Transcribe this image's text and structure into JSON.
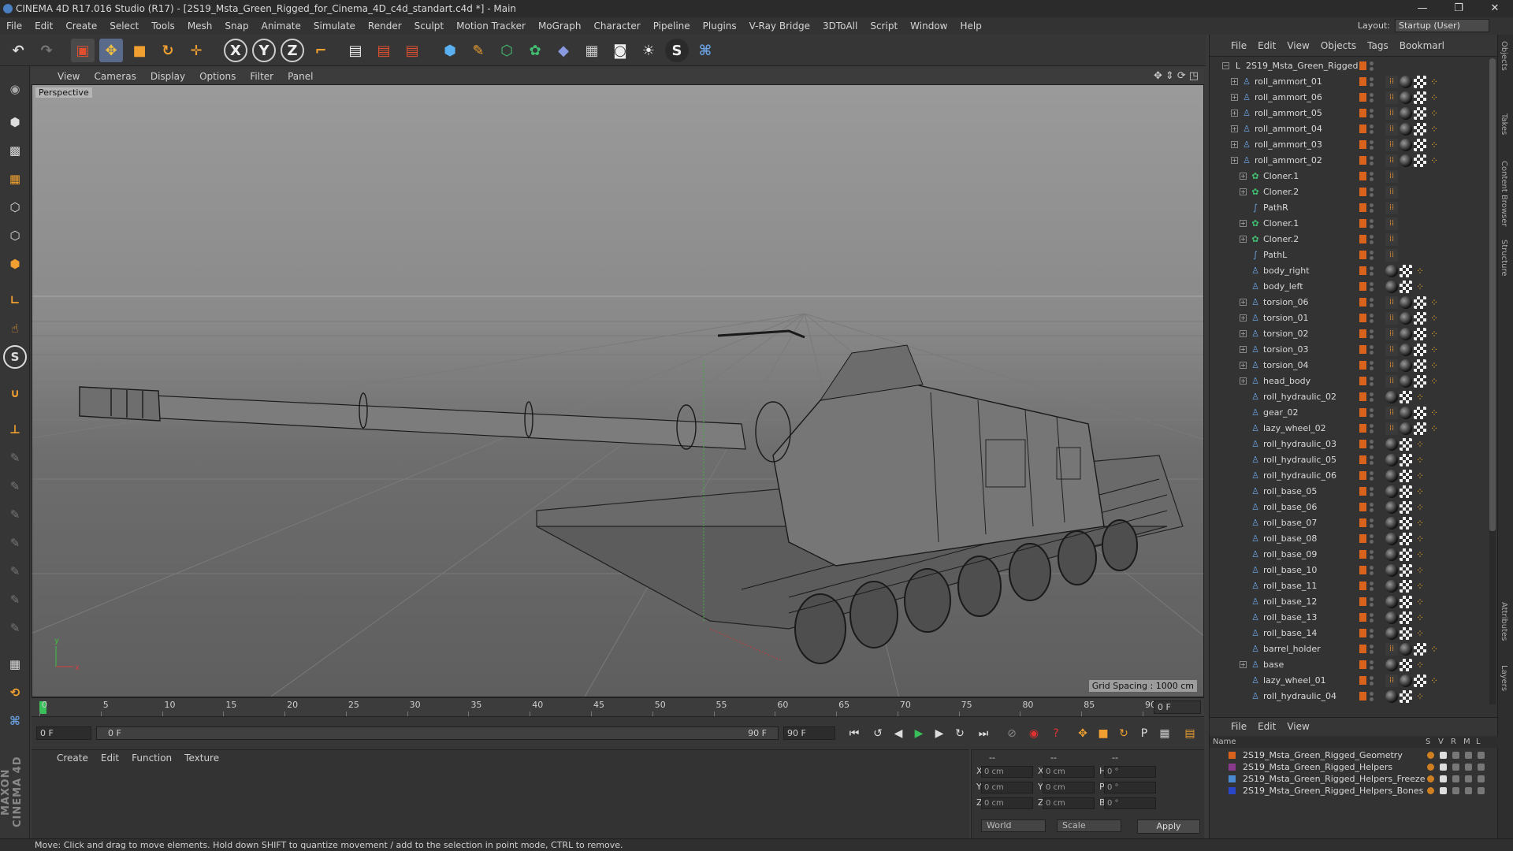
{
  "window": {
    "title": "CINEMA 4D R17.016 Studio (R17) - [2S19_Msta_Green_Rigged_for_Cinema_4D_c4d_standart.c4d *] - Main",
    "buttons": [
      "—",
      "❐",
      "✕"
    ]
  },
  "menubar": {
    "items": [
      "File",
      "Edit",
      "Create",
      "Select",
      "Tools",
      "Mesh",
      "Snap",
      "Animate",
      "Simulate",
      "Render",
      "Sculpt",
      "Motion Tracker",
      "MoGraph",
      "Character",
      "Pipeline",
      "Plugins",
      "V-Ray Bridge",
      "3DToAll",
      "Script",
      "Window",
      "Help"
    ],
    "layout_label": "Layout:",
    "layout_value": "Startup (User)"
  },
  "toolbar": {
    "axis_x": "X",
    "axis_y": "Y",
    "axis_z": "Z"
  },
  "viewport": {
    "menu": [
      "View",
      "Cameras",
      "Display",
      "Options",
      "Filter",
      "Panel"
    ],
    "label": "Perspective",
    "grid_spacing": "Grid Spacing : 1000 cm"
  },
  "timeline": {
    "ticks": [
      "0",
      "5",
      "10",
      "15",
      "20",
      "25",
      "30",
      "35",
      "40",
      "45",
      "50",
      "55",
      "60",
      "65",
      "70",
      "75",
      "80",
      "85",
      "90"
    ],
    "end_field": "0 F"
  },
  "playbar": {
    "current_frame": "0 F",
    "range_start": "0 F",
    "range_end_inner": "90 F",
    "range_end": "90 F"
  },
  "material_panel": {
    "menu": [
      "Create",
      "Edit",
      "Function",
      "Texture"
    ]
  },
  "coords": {
    "header_a": "--",
    "header_b": "--",
    "header_c": "--",
    "rows": [
      {
        "axis": "X",
        "pos": "0 cm",
        "axis2": "X",
        "size": "0 cm",
        "axis3": "H",
        "rot": "0 °"
      },
      {
        "axis": "Y",
        "pos": "0 cm",
        "axis2": "Y",
        "size": "0 cm",
        "axis3": "P",
        "rot": "0 °"
      },
      {
        "axis": "Z",
        "pos": "0 cm",
        "axis2": "Z",
        "size": "0 cm",
        "axis3": "B",
        "rot": "0 °"
      }
    ],
    "world_select": "World",
    "scale_select": "Scale",
    "apply": "Apply"
  },
  "object_manager": {
    "menu": [
      "File",
      "Edit",
      "View",
      "Objects",
      "Tags",
      "Bookmarl"
    ],
    "objects": [
      {
        "name": "2S19_Msta_Green_Rigged",
        "indent": 0,
        "icon": "null",
        "expand": "−",
        "tags": []
      },
      {
        "name": "roll_ammort_01",
        "indent": 1,
        "icon": "joint",
        "expand": "+",
        "tags": [
          "tex",
          "sph",
          "chk",
          "dot"
        ]
      },
      {
        "name": "roll_ammort_06",
        "indent": 1,
        "icon": "joint",
        "expand": "+",
        "tags": [
          "tex",
          "sph",
          "chk",
          "dot"
        ]
      },
      {
        "name": "roll_ammort_05",
        "indent": 1,
        "icon": "joint",
        "expand": "+",
        "tags": [
          "tex",
          "sph",
          "chk",
          "dot"
        ]
      },
      {
        "name": "roll_ammort_04",
        "indent": 1,
        "icon": "joint",
        "expand": "+",
        "tags": [
          "tex",
          "sph",
          "chk",
          "dot"
        ]
      },
      {
        "name": "roll_ammort_03",
        "indent": 1,
        "icon": "joint",
        "expand": "+",
        "tags": [
          "tex",
          "sph",
          "chk",
          "dot"
        ]
      },
      {
        "name": "roll_ammort_02",
        "indent": 1,
        "icon": "joint",
        "expand": "+",
        "tags": [
          "tex",
          "sph",
          "chk",
          "dot"
        ]
      },
      {
        "name": "Cloner.1",
        "indent": 2,
        "icon": "cloner",
        "expand": "+",
        "tags": [
          "tex"
        ]
      },
      {
        "name": "Cloner.2",
        "indent": 2,
        "icon": "cloner",
        "expand": "+",
        "tags": [
          "tex"
        ]
      },
      {
        "name": "PathR",
        "indent": 2,
        "icon": "spline",
        "expand": "",
        "tags": [
          "tex"
        ]
      },
      {
        "name": "Cloner.1",
        "indent": 2,
        "icon": "cloner",
        "expand": "+",
        "tags": [
          "tex"
        ]
      },
      {
        "name": "Cloner.2",
        "indent": 2,
        "icon": "cloner",
        "expand": "+",
        "tags": [
          "tex"
        ]
      },
      {
        "name": "PathL",
        "indent": 2,
        "icon": "spline",
        "expand": "",
        "tags": [
          "tex"
        ]
      },
      {
        "name": "body_right",
        "indent": 2,
        "icon": "joint",
        "expand": "",
        "tags": [
          "sph",
          "chk",
          "dot"
        ]
      },
      {
        "name": "body_left",
        "indent": 2,
        "icon": "joint",
        "expand": "",
        "tags": [
          "sph",
          "chk",
          "dot"
        ]
      },
      {
        "name": "torsion_06",
        "indent": 2,
        "icon": "joint",
        "expand": "+",
        "tags": [
          "tex",
          "sph",
          "chk",
          "dot"
        ]
      },
      {
        "name": "torsion_01",
        "indent": 2,
        "icon": "joint",
        "expand": "+",
        "tags": [
          "tex",
          "sph",
          "chk",
          "dot"
        ]
      },
      {
        "name": "torsion_02",
        "indent": 2,
        "icon": "joint",
        "expand": "+",
        "tags": [
          "tex",
          "sph",
          "chk",
          "dot"
        ]
      },
      {
        "name": "torsion_03",
        "indent": 2,
        "icon": "joint",
        "expand": "+",
        "tags": [
          "tex",
          "sph",
          "chk",
          "dot"
        ]
      },
      {
        "name": "torsion_04",
        "indent": 2,
        "icon": "joint",
        "expand": "+",
        "tags": [
          "tex",
          "sph",
          "chk",
          "dot"
        ]
      },
      {
        "name": "head_body",
        "indent": 2,
        "icon": "joint",
        "expand": "+",
        "tags": [
          "tex",
          "sph",
          "chk",
          "dot"
        ]
      },
      {
        "name": "roll_hydraulic_02",
        "indent": 2,
        "icon": "joint",
        "expand": "",
        "tags": [
          "sph",
          "chk",
          "dot"
        ]
      },
      {
        "name": "gear_02",
        "indent": 2,
        "icon": "joint",
        "expand": "",
        "tags": [
          "tex",
          "sph",
          "chk",
          "dot"
        ]
      },
      {
        "name": "lazy_wheel_02",
        "indent": 2,
        "icon": "joint",
        "expand": "",
        "tags": [
          "tex",
          "sph",
          "chk",
          "dot"
        ]
      },
      {
        "name": "roll_hydraulic_03",
        "indent": 2,
        "icon": "joint",
        "expand": "",
        "tags": [
          "sph",
          "chk",
          "dot"
        ]
      },
      {
        "name": "roll_hydraulic_05",
        "indent": 2,
        "icon": "joint",
        "expand": "",
        "tags": [
          "sph",
          "chk",
          "dot"
        ]
      },
      {
        "name": "roll_hydraulic_06",
        "indent": 2,
        "icon": "joint",
        "expand": "",
        "tags": [
          "sph",
          "chk",
          "dot"
        ]
      },
      {
        "name": "roll_base_05",
        "indent": 2,
        "icon": "joint",
        "expand": "",
        "tags": [
          "sph",
          "chk",
          "dot"
        ]
      },
      {
        "name": "roll_base_06",
        "indent": 2,
        "icon": "joint",
        "expand": "",
        "tags": [
          "sph",
          "chk",
          "dot"
        ]
      },
      {
        "name": "roll_base_07",
        "indent": 2,
        "icon": "joint",
        "expand": "",
        "tags": [
          "sph",
          "chk",
          "dot"
        ]
      },
      {
        "name": "roll_base_08",
        "indent": 2,
        "icon": "joint",
        "expand": "",
        "tags": [
          "sph",
          "chk",
          "dot"
        ]
      },
      {
        "name": "roll_base_09",
        "indent": 2,
        "icon": "joint",
        "expand": "",
        "tags": [
          "sph",
          "chk",
          "dot"
        ]
      },
      {
        "name": "roll_base_10",
        "indent": 2,
        "icon": "joint",
        "expand": "",
        "tags": [
          "sph",
          "chk",
          "dot"
        ]
      },
      {
        "name": "roll_base_11",
        "indent": 2,
        "icon": "joint",
        "expand": "",
        "tags": [
          "sph",
          "chk",
          "dot"
        ]
      },
      {
        "name": "roll_base_12",
        "indent": 2,
        "icon": "joint",
        "expand": "",
        "tags": [
          "sph",
          "chk",
          "dot"
        ]
      },
      {
        "name": "roll_base_13",
        "indent": 2,
        "icon": "joint",
        "expand": "",
        "tags": [
          "sph",
          "chk",
          "dot"
        ]
      },
      {
        "name": "roll_base_14",
        "indent": 2,
        "icon": "joint",
        "expand": "",
        "tags": [
          "sph",
          "chk",
          "dot"
        ]
      },
      {
        "name": "barrel_holder",
        "indent": 2,
        "icon": "joint",
        "expand": "",
        "tags": [
          "tex",
          "sph",
          "chk",
          "dot"
        ]
      },
      {
        "name": "base",
        "indent": 2,
        "icon": "joint",
        "expand": "+",
        "tags": [
          "sph",
          "chk",
          "dot"
        ]
      },
      {
        "name": "lazy_wheel_01",
        "indent": 2,
        "icon": "joint",
        "expand": "",
        "tags": [
          "tex",
          "sph",
          "chk",
          "dot"
        ]
      },
      {
        "name": "roll_hydraulic_04",
        "indent": 2,
        "icon": "joint",
        "expand": "",
        "tags": [
          "sph",
          "chk",
          "dot"
        ]
      }
    ]
  },
  "layer_manager": {
    "menu": [
      "File",
      "Edit",
      "View"
    ],
    "columns": [
      "Name",
      "S",
      "V",
      "R",
      "M",
      "L"
    ],
    "layers": [
      {
        "name": "2S19_Msta_Green_Rigged_Geometry",
        "color": "#d9621c"
      },
      {
        "name": "2S19_Msta_Green_Rigged_Helpers",
        "color": "#8a3a8a"
      },
      {
        "name": "2S19_Msta_Green_Rigged_Helpers_Freeze",
        "color": "#4a8ad0"
      },
      {
        "name": "2S19_Msta_Green_Rigged_Helpers_Bones",
        "color": "#2a46c8"
      }
    ]
  },
  "side_tabs": [
    "Objects",
    "Takes",
    "Content Browser",
    "Structure",
    "Attributes",
    "Layers"
  ],
  "status": {
    "text": "Move: Click and drag to move elements. Hold down SHIFT to quantize movement / add to the selection in point mode, CTRL to remove."
  },
  "brand": {
    "text": "MAXON CINEMA 4D"
  }
}
